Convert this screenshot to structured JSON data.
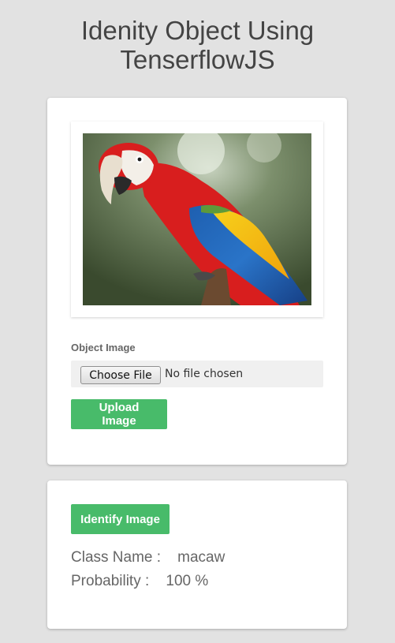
{
  "header": {
    "title_line1": "Idenity Object Using",
    "title_line2": "TenserflowJS"
  },
  "upload_card": {
    "image_alt": "macaw parrot",
    "field_label": "Object Image",
    "file_button_label": "Choose File",
    "file_status": "No file chosen",
    "upload_button_label": "Upload Image"
  },
  "identify_card": {
    "identify_button_label": "Identify Image",
    "class_label": "Class Name :",
    "class_value": "macaw",
    "probability_label": "Probability :",
    "probability_value": "100 %"
  },
  "colors": {
    "background": "#e2e2e2",
    "card": "#ffffff",
    "accent_green": "#48bb6a",
    "title_text": "#444444",
    "body_text": "#666666"
  }
}
